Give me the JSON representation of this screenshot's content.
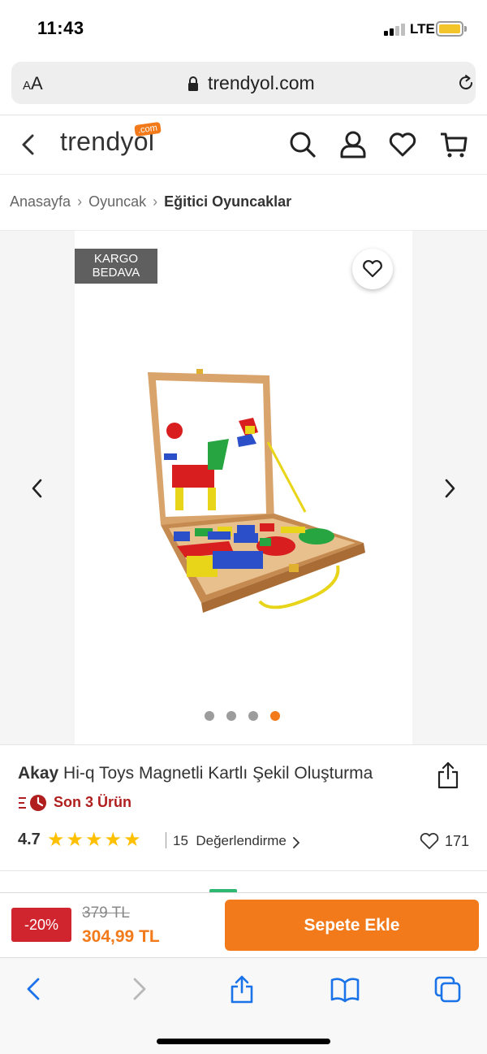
{
  "status_bar": {
    "time": "11:43",
    "network": "LTE"
  },
  "browser": {
    "text_size_label": "AA",
    "url": "trendyol.com"
  },
  "site": {
    "logo": "trendyol",
    "logo_badge": ".com",
    "icons": [
      "back-icon",
      "search-icon",
      "user-icon",
      "heart-icon",
      "cart-icon"
    ]
  },
  "breadcrumb": {
    "items": [
      "Anasayfa",
      "Oyuncak"
    ],
    "current": "Eğitici Oyuncaklar"
  },
  "gallery": {
    "badge_line1": "KARGO",
    "badge_line2": "BEDAVA",
    "image_count": 4,
    "active_image": 4
  },
  "product": {
    "brand": "Akay",
    "name": "Hi-q Toys Magnetli Kartlı Şekil Oluşturma",
    "stock_text": "Son 3 Ürün",
    "rating": "4.7",
    "stars": 5,
    "review_count": "15",
    "review_label": "Değerlendirme",
    "favorite_count": "171"
  },
  "buy_bar": {
    "discount": "-20%",
    "old_price": "379 TL",
    "new_price": "304,99 TL",
    "add_to_cart_label": "Sepete Ekle"
  },
  "colors": {
    "brand_orange": "#f27a1a",
    "discount_red": "#d0252f",
    "stock_red": "#b01e1e",
    "star_yellow": "#ffc000",
    "safari_blue": "#1a73e8"
  }
}
